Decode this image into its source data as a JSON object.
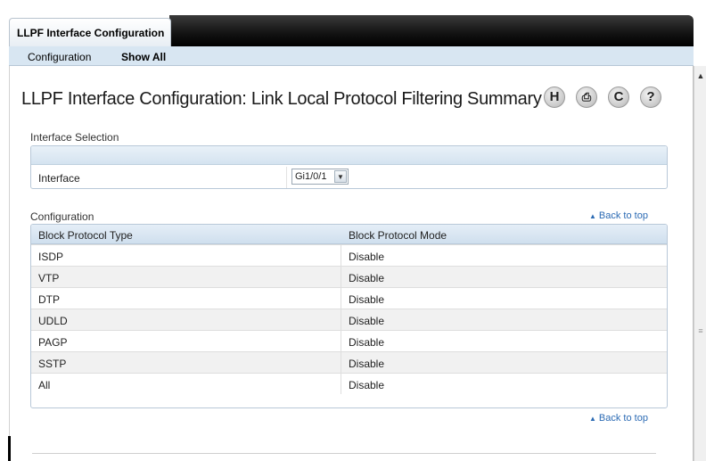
{
  "tabs": {
    "active_label": "LLPF Interface Configuration"
  },
  "subnav": {
    "items": [
      {
        "label": "Configuration"
      },
      {
        "label": "Show All"
      }
    ]
  },
  "page": {
    "title": "LLPF Interface Configuration: Link Local Protocol Filtering Summary"
  },
  "toolbar": {
    "icons": [
      {
        "name": "help-h-icon",
        "glyph": "H"
      },
      {
        "name": "print-icon",
        "glyph": "⎙"
      },
      {
        "name": "refresh-icon",
        "glyph": "C"
      },
      {
        "name": "help-icon",
        "glyph": "?"
      }
    ]
  },
  "interface_selection": {
    "section_label": "Interface Selection",
    "interface_label": "Interface",
    "interface_value": "Gi1/0/1"
  },
  "configuration": {
    "section_label": "Configuration",
    "back_to_top": "Back to top",
    "columns": [
      "Block Protocol Type",
      "Block Protocol Mode"
    ],
    "rows": [
      {
        "type": "ISDP",
        "mode": "Disable"
      },
      {
        "type": "VTP",
        "mode": "Disable"
      },
      {
        "type": "DTP",
        "mode": "Disable"
      },
      {
        "type": "UDLD",
        "mode": "Disable"
      },
      {
        "type": "PAGP",
        "mode": "Disable"
      },
      {
        "type": "SSTP",
        "mode": "Disable"
      },
      {
        "type": "All",
        "mode": "Disable"
      }
    ]
  },
  "colors": {
    "link": "#2c6bb4",
    "header_blue": "#d8e6f2",
    "tab_bar": "#121212"
  }
}
